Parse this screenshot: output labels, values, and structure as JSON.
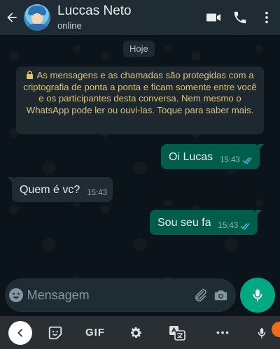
{
  "header": {
    "contact_name": "Luccas Neto",
    "contact_status": "online",
    "icons": [
      "back-arrow-icon",
      "video-call-icon",
      "phone-icon",
      "more-vert-icon"
    ]
  },
  "chat": {
    "date_chip": "Hoje",
    "system_message": "As mensagens e as chamadas são protegidas com a criptografia de ponta a ponta e ficam somente entre você e os participantes desta conversa. Nem mesmo o WhatsApp pode ler ou ouvi-las. Toque para saber mais.",
    "messages": [
      {
        "direction": "out",
        "text": "Oi Lucas",
        "time": "15:43",
        "status": "read"
      },
      {
        "direction": "in",
        "text": "Quem é vc?",
        "time": "15:43"
      },
      {
        "direction": "out",
        "text": "Sou seu fa",
        "time": "15:43",
        "status": "read"
      }
    ]
  },
  "composer": {
    "placeholder": "Mensagem",
    "icons": [
      "emoji-icon",
      "attach-icon",
      "camera-icon",
      "mic-icon"
    ]
  },
  "keyboard_toolbar": {
    "gif_label": "GIF",
    "more_label": "•••",
    "icons": [
      "chevron-left-icon",
      "sticker-icon",
      "settings-icon",
      "translate-icon",
      "mic-icon"
    ]
  },
  "colors": {
    "header_bg": "#1f2c34",
    "chat_bg": "#0b141a",
    "outgoing_bubble": "#005c4b",
    "incoming_bubble": "#1f2c34",
    "system_text": "#ddc57b",
    "accent": "#00a884",
    "read_ticks": "#53bdeb"
  }
}
